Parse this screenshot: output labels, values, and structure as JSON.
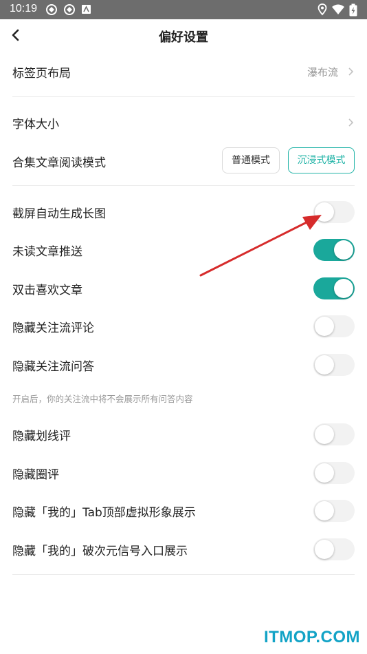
{
  "status_bar": {
    "time": "10:19"
  },
  "header": {
    "title": "偏好设置"
  },
  "settings": {
    "tab_layout": {
      "label": "标签页布局",
      "value": "瀑布流"
    },
    "font_size": {
      "label": "字体大小"
    },
    "collection_mode": {
      "label": "合集文章阅读模式",
      "option_normal": "普通模式",
      "option_immersive": "沉浸式模式",
      "selected": "沉浸式模式"
    },
    "toggles": [
      {
        "label": "截屏自动生成长图",
        "on": false
      },
      {
        "label": "未读文章推送",
        "on": true
      },
      {
        "label": "双击喜欢文章",
        "on": true
      },
      {
        "label": "隐藏关注流评论",
        "on": false
      },
      {
        "label": "隐藏关注流问答",
        "on": false
      },
      {
        "label": "隐藏划线评",
        "on": false
      },
      {
        "label": "隐藏圈评",
        "on": false
      },
      {
        "label": "隐藏「我的」Tab顶部虚拟形象展示",
        "on": false
      },
      {
        "label": "隐藏「我的」破次元信号入口展示",
        "on": false
      }
    ],
    "hint_text": "开启后，你的关注流中将不会展示所有问答内容"
  },
  "colors": {
    "accent": "#1aa89b",
    "annotation_arrow": "#d62b2b",
    "watermark": "#12a3c6"
  },
  "watermark": "ITMOP.COM"
}
